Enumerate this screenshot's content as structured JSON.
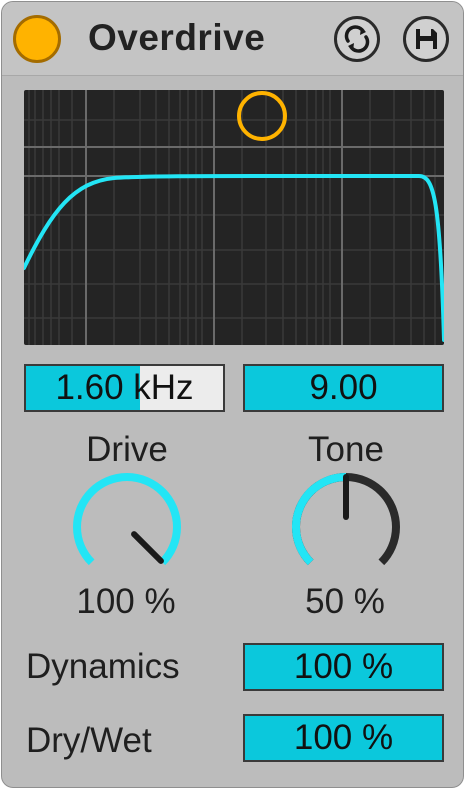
{
  "device": {
    "title": "Overdrive",
    "power_on": true,
    "accent_color": "#0bc8dc",
    "power_color": "#ffb300",
    "icons": {
      "power": "power-toggle-icon",
      "hotswap": "hot-swap-icon",
      "save": "save-preset-icon"
    }
  },
  "filter": {
    "frequency": "1.60 kHz",
    "width": "9.00"
  },
  "knobs": {
    "drive": {
      "label": "Drive",
      "value": "100 %",
      "level": 1.0
    },
    "tone": {
      "label": "Tone",
      "value": "50 %",
      "level": 0.5
    }
  },
  "dynamics": {
    "label": "Dynamics",
    "value": "100 %"
  },
  "drywet": {
    "label": "Dry/Wet",
    "value": "100 %"
  }
}
